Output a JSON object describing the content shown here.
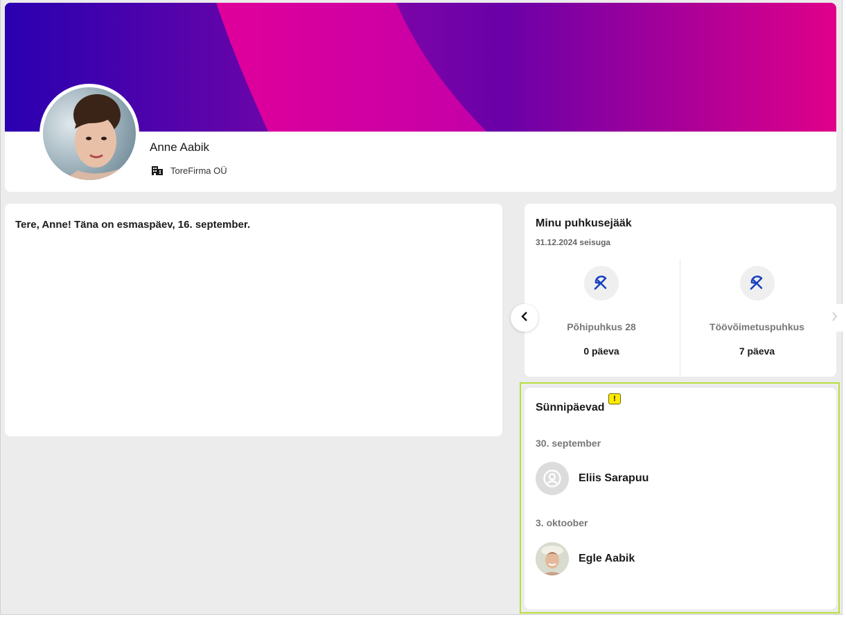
{
  "profile": {
    "name": "Anne Aabik",
    "company": "ToreFirma OÜ"
  },
  "greeting": "Tere, Anne! Täna on esmaspäev, 16. september.",
  "vacation": {
    "title": "Minu puhkusejääk",
    "subtitle": "31.12.2024 seisuga",
    "items": [
      {
        "label": "Põhipuhkus 28",
        "value": "0 päeva",
        "icon": "umbrella-icon"
      },
      {
        "label": "Töövõimetuspuhkus",
        "value": "7 päeva",
        "icon": "umbrella-icon"
      }
    ]
  },
  "birthdays": {
    "title": "Sünnipäevad",
    "badge": "!",
    "groups": [
      {
        "date": "30. september",
        "person": "Eliis Sarapuu",
        "avatar": "placeholder-avatar"
      },
      {
        "date": "3. oktoober",
        "person": "Egle Aabik",
        "avatar": "photo-avatar"
      }
    ]
  },
  "colors": {
    "banner_start": "#2a00b0",
    "banner_pink": "#e0009a",
    "banner_purple": "#6a00a8",
    "accent_blue": "#1a40c0",
    "highlight_outline": "#b7de3c"
  }
}
